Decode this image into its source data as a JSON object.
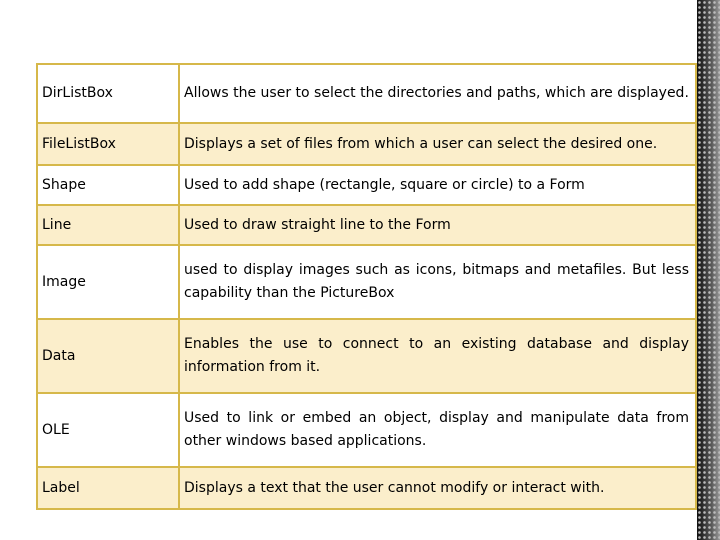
{
  "rows": [
    {
      "name": "DirListBox",
      "desc": "Allows the user to select the directories and paths, which are displayed."
    },
    {
      "name": "FileListBox",
      "desc": "Displays a set of files from which a user can select the desired one."
    },
    {
      "name": "Shape",
      "desc": "Used to add shape (rectangle, square or circle) to a Form"
    },
    {
      "name": "Line",
      "desc": "Used to draw straight line to the Form"
    },
    {
      "name": "Image",
      "desc": "used to display images such as icons, bitmaps and metafiles. But less capability than the PictureBox"
    },
    {
      "name": "Data",
      "desc": "Enables the use to connect to an existing database and display information from it."
    },
    {
      "name": "OLE",
      "desc": "Used to link or embed an object, display and manipulate data from other windows based applications."
    },
    {
      "name": "Label",
      "desc": "Displays a text that the user cannot modify or interact with."
    }
  ],
  "colors": {
    "border": "#d6b84a",
    "row_alt": "#fbeecb"
  }
}
